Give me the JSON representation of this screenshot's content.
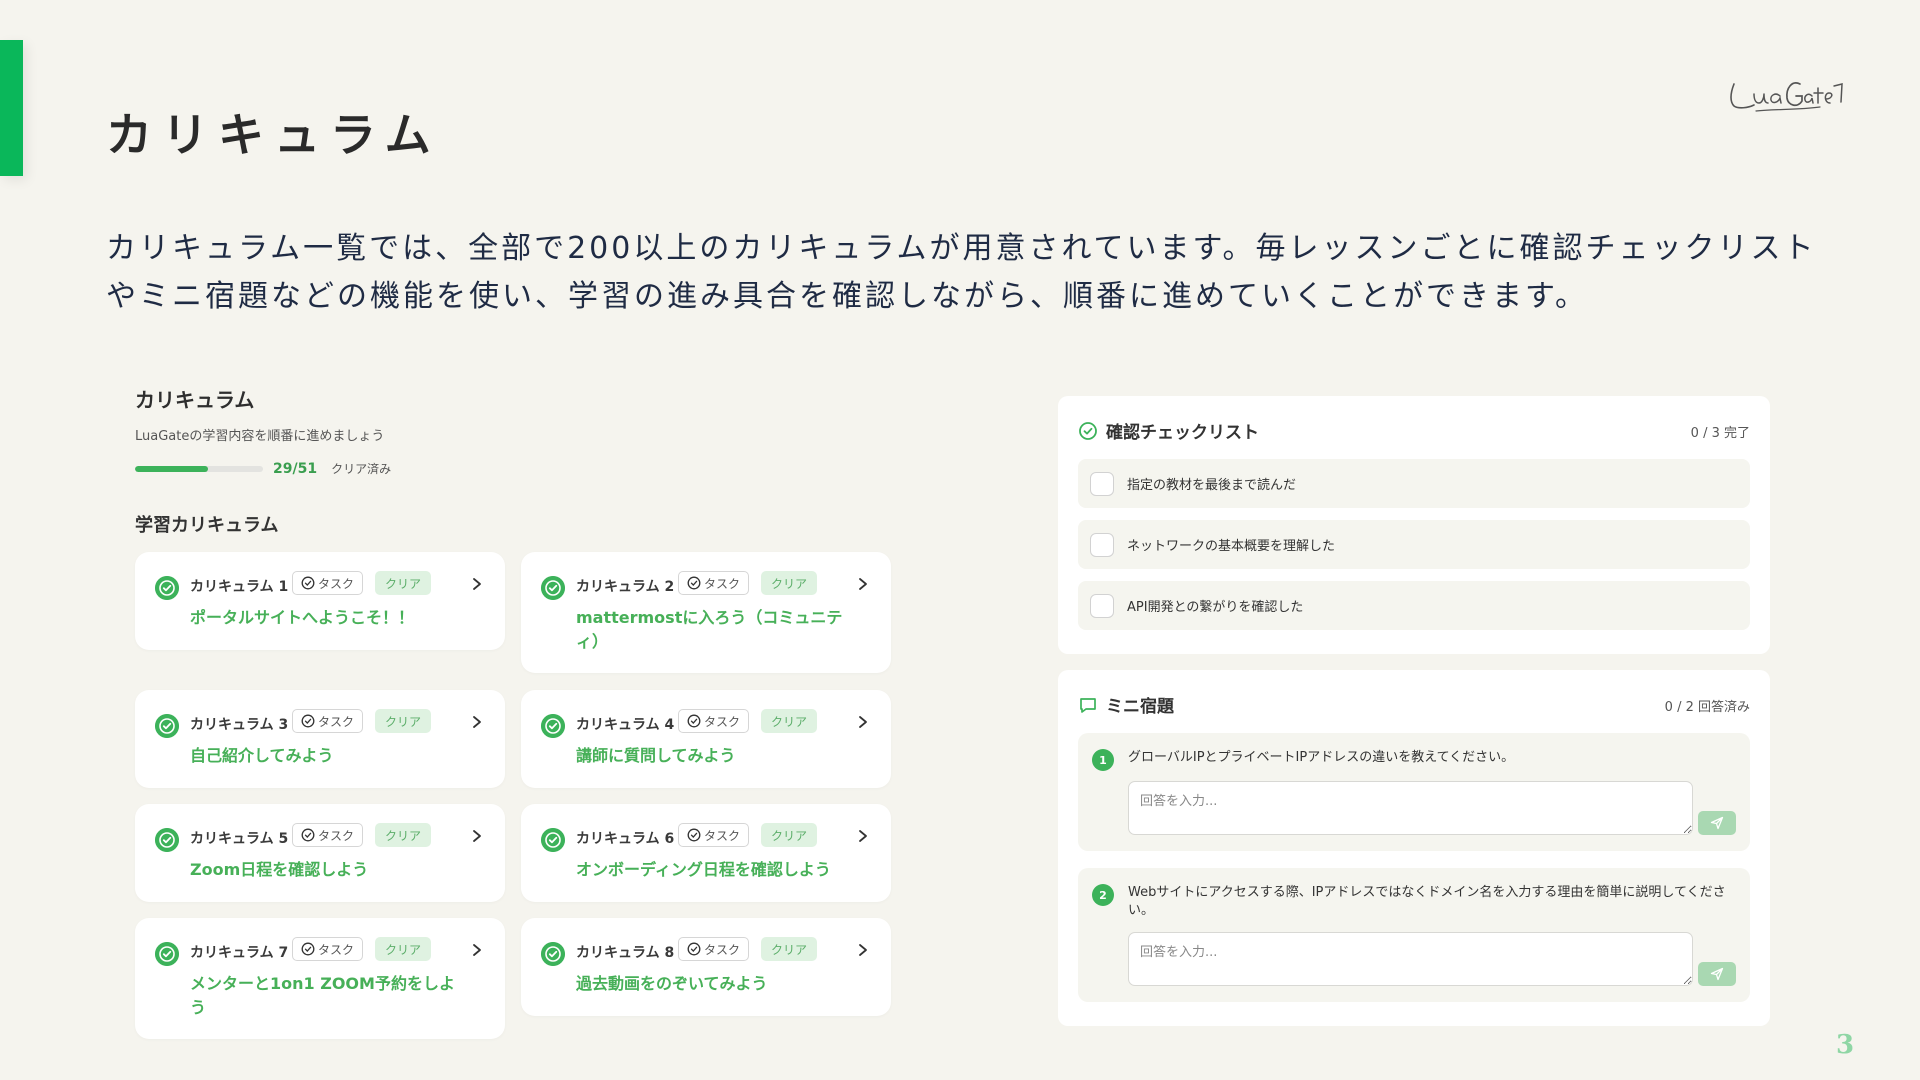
{
  "slide": {
    "title": "カリキュラム",
    "description": "カリキュラム一覧では、全部で200以上のカリキュラムが用意されています。毎レッスンごとに確認チェックリストやミニ宿題などの機能を使い、学習の進み具合を確認しながら、順番に進めていくことができます。",
    "page_number": "3",
    "logo_text": "LuaGate"
  },
  "curriculum": {
    "title": "カリキュラム",
    "subtitle": "LuaGateの学習内容を順番に進めましょう",
    "progress": {
      "count": "29/51",
      "status": "クリア済み",
      "fraction": 0.5686
    },
    "section_title": "学習カリキュラム",
    "items": [
      {
        "label": "カリキュラム 1",
        "task": "タスク",
        "status": "クリア",
        "title": "ポータルサイトへようこそ！！"
      },
      {
        "label": "カリキュラム 2",
        "task": "タスク",
        "status": "クリア",
        "title": "mattermostに入ろう（コミュニティ）"
      },
      {
        "label": "カリキュラム 3",
        "task": "タスク",
        "status": "クリア",
        "title": "自己紹介してみよう"
      },
      {
        "label": "カリキュラム 4",
        "task": "タスク",
        "status": "クリア",
        "title": "講師に質問してみよう"
      },
      {
        "label": "カリキュラム 5",
        "task": "タスク",
        "status": "クリア",
        "title": "Zoom日程を確認しよう"
      },
      {
        "label": "カリキュラム 6",
        "task": "タスク",
        "status": "クリア",
        "title": "オンボーディング日程を確認しよう"
      },
      {
        "label": "カリキュラム 7",
        "task": "タスク",
        "status": "クリア",
        "title": "メンターと1on1 ZOOM予約をしよう"
      },
      {
        "label": "カリキュラム 8",
        "task": "タスク",
        "status": "クリア",
        "title": "過去動画をのぞいてみよう"
      }
    ]
  },
  "checklist": {
    "title": "確認チェックリスト",
    "count": "0 / 3 完了",
    "items": [
      {
        "text": "指定の教材を最後まで読んだ",
        "checked": false
      },
      {
        "text": "ネットワークの基本概要を理解した",
        "checked": false
      },
      {
        "text": "API開発との繋がりを確認した",
        "checked": false
      }
    ]
  },
  "homework": {
    "title": "ミニ宿題",
    "count": "0 / 2 回答済み",
    "questions": [
      {
        "number": "1",
        "text": "グローバルIPとプライベートIPアドレスの違いを教えてください。",
        "placeholder": "回答を入力..."
      },
      {
        "number": "2",
        "text": "Webサイトにアクセスする際、IPアドレスではなくドメイン名を入力する理由を簡単に説明してください。",
        "placeholder": "回答を入力..."
      }
    ]
  },
  "colors": {
    "accent": "#0ab75a",
    "success": "#3cb25a",
    "background": "#f5f4ee"
  },
  "icons": {
    "check": "check-circle-icon",
    "task": "task-check-icon",
    "chevron": "chevron-right-icon",
    "chat": "chat-bubble-icon",
    "send": "send-icon"
  }
}
